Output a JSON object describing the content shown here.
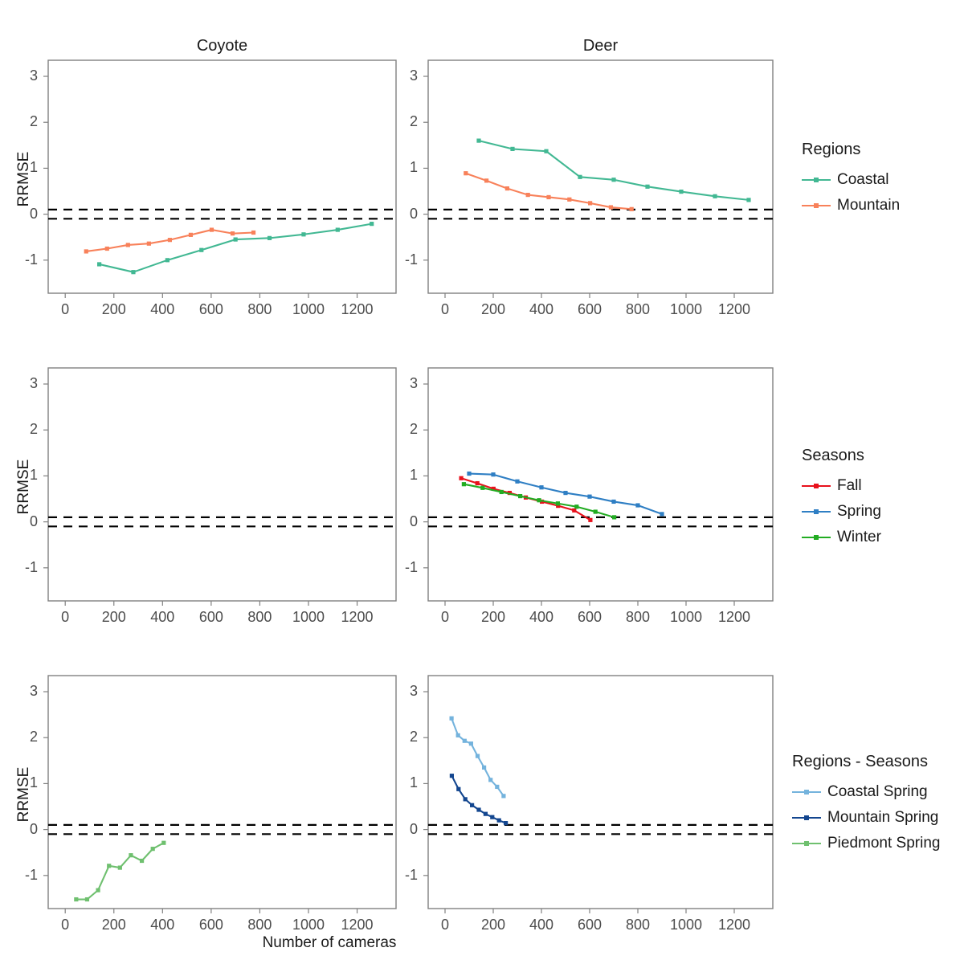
{
  "figure": {
    "x_axis_label": "Number of cameras",
    "y_axis_label": "RRMSE",
    "column_titles": [
      "Coyote",
      "Deer"
    ],
    "x_ticks": [
      0,
      200,
      400,
      600,
      800,
      1000,
      1200
    ],
    "y_ticks": [
      3,
      2,
      1,
      0,
      -1
    ],
    "x_range": [
      -70,
      1360
    ],
    "y_range": [
      -1.72,
      3.35
    ],
    "reference_lines": [
      0.1,
      -0.1
    ],
    "reference_line_style": "dashed",
    "reference_line_color": "#000000",
    "panel_border_color": "#808080",
    "background": "#ffffff"
  },
  "legends": [
    {
      "title": "Regions",
      "items": [
        {
          "label": "Coastal",
          "color": "#42b893"
        },
        {
          "label": "Mountain",
          "color": "#f8815a"
        }
      ]
    },
    {
      "title": "Seasons",
      "items": [
        {
          "label": "Fall",
          "color": "#e8111c"
        },
        {
          "label": "Spring",
          "color": "#2f7fc4"
        },
        {
          "label": "Winter",
          "color": "#22ac22"
        }
      ]
    },
    {
      "title": "Regions - Seasons",
      "items": [
        {
          "label": "Coastal Spring",
          "color": "#74b3dd"
        },
        {
          "label": "Mountain Spring",
          "color": "#13468f"
        },
        {
          "label": "Piedmont Spring",
          "color": "#6fc06f"
        }
      ]
    }
  ],
  "chart_data": [
    {
      "type": "line",
      "title": "Coyote",
      "row": 1,
      "grouping": "Regions",
      "xlabel": "Number of cameras",
      "ylabel": "RRMSE",
      "xlim": [
        -70,
        1360
      ],
      "ylim": [
        -1.72,
        3.35
      ],
      "grid": false,
      "legend_position": "right",
      "series": [
        {
          "name": "Coastal",
          "color": "#42b893",
          "x": [
            140,
            280,
            420,
            560,
            700,
            840,
            980,
            1120,
            1260
          ],
          "y": [
            -1.09,
            -1.26,
            -1.0,
            -0.78,
            -0.55,
            -0.52,
            -0.44,
            -0.34,
            -0.21
          ]
        },
        {
          "name": "Mountain",
          "color": "#f8815a",
          "x": [
            86,
            172,
            258,
            344,
            430,
            516,
            602,
            688,
            774
          ],
          "y": [
            -0.81,
            -0.75,
            -0.67,
            -0.64,
            -0.56,
            -0.45,
            -0.34,
            -0.42,
            -0.4
          ]
        }
      ]
    },
    {
      "type": "line",
      "title": "Deer",
      "row": 1,
      "grouping": "Regions",
      "xlabel": "Number of cameras",
      "ylabel": "RRMSE",
      "xlim": [
        -70,
        1360
      ],
      "ylim": [
        -1.72,
        3.35
      ],
      "grid": false,
      "legend_position": "right",
      "series": [
        {
          "name": "Coastal",
          "color": "#42b893",
          "x": [
            140,
            280,
            420,
            560,
            700,
            840,
            980,
            1120,
            1260
          ],
          "y": [
            1.6,
            1.42,
            1.37,
            0.81,
            0.75,
            0.6,
            0.49,
            0.39,
            0.31
          ]
        },
        {
          "name": "Mountain",
          "color": "#f8815a",
          "x": [
            86,
            172,
            258,
            344,
            430,
            516,
            602,
            688,
            774
          ],
          "y": [
            0.89,
            0.73,
            0.56,
            0.42,
            0.37,
            0.32,
            0.24,
            0.15,
            0.11
          ]
        }
      ]
    },
    {
      "type": "line",
      "title": "Coyote",
      "row": 2,
      "grouping": "Seasons",
      "xlabel": "Number of cameras",
      "ylabel": "RRMSE",
      "xlim": [
        -70,
        1360
      ],
      "ylim": [
        -1.72,
        3.35
      ],
      "grid": false,
      "legend_position": "right",
      "series": []
    },
    {
      "type": "line",
      "title": "Deer",
      "row": 2,
      "grouping": "Seasons",
      "xlabel": "Number of cameras",
      "ylabel": "RRMSE",
      "xlim": [
        -70,
        1360
      ],
      "ylim": [
        -1.72,
        3.35
      ],
      "grid": false,
      "legend_position": "right",
      "series": [
        {
          "name": "Fall",
          "color": "#e8111c",
          "x": [
            67,
            134,
            201,
            268,
            335,
            402,
            469,
            536,
            603
          ],
          "y": [
            0.95,
            0.84,
            0.72,
            0.63,
            0.53,
            0.44,
            0.35,
            0.25,
            0.04
          ]
        },
        {
          "name": "Spring",
          "color": "#2f7fc4",
          "x": [
            100,
            200,
            300,
            400,
            500,
            600,
            700,
            800,
            900
          ],
          "y": [
            1.05,
            1.03,
            0.88,
            0.75,
            0.63,
            0.55,
            0.44,
            0.36,
            0.17
          ]
        },
        {
          "name": "Winter",
          "color": "#22ac22",
          "x": [
            78,
            156,
            234,
            312,
            390,
            468,
            546,
            624,
            702
          ],
          "y": [
            0.82,
            0.74,
            0.65,
            0.56,
            0.47,
            0.4,
            0.33,
            0.22,
            0.1
          ]
        }
      ]
    },
    {
      "type": "line",
      "title": "Coyote",
      "row": 3,
      "grouping": "Regions - Seasons",
      "xlabel": "Number of cameras",
      "ylabel": "RRMSE",
      "xlim": [
        -70,
        1360
      ],
      "ylim": [
        -1.72,
        3.35
      ],
      "grid": false,
      "legend_position": "right",
      "series": [
        {
          "name": "Piedmont Spring",
          "color": "#6fc06f",
          "x": [
            45,
            90,
            135,
            180,
            225,
            270,
            315,
            360,
            405
          ],
          "y": [
            -1.52,
            -1.52,
            -1.32,
            -0.79,
            -0.83,
            -0.56,
            -0.68,
            -0.42,
            -0.29
          ]
        }
      ]
    },
    {
      "type": "line",
      "title": "Deer",
      "row": 3,
      "grouping": "Regions - Seasons",
      "xlabel": "Number of cameras",
      "ylabel": "RRMSE",
      "xlim": [
        -70,
        1360
      ],
      "ylim": [
        -1.72,
        3.35
      ],
      "grid": false,
      "legend_position": "right",
      "series": [
        {
          "name": "Coastal Spring",
          "color": "#74b3dd",
          "x": [
            27,
            54,
            81,
            108,
            135,
            162,
            189,
            216,
            243
          ],
          "y": [
            2.42,
            2.05,
            1.93,
            1.87,
            1.6,
            1.35,
            1.08,
            0.93,
            0.73
          ]
        },
        {
          "name": "Mountain Spring",
          "color": "#13468f",
          "x": [
            28,
            56,
            84,
            112,
            140,
            168,
            196,
            224,
            252
          ],
          "y": [
            1.17,
            0.88,
            0.66,
            0.53,
            0.43,
            0.34,
            0.27,
            0.2,
            0.14
          ]
        }
      ]
    }
  ]
}
